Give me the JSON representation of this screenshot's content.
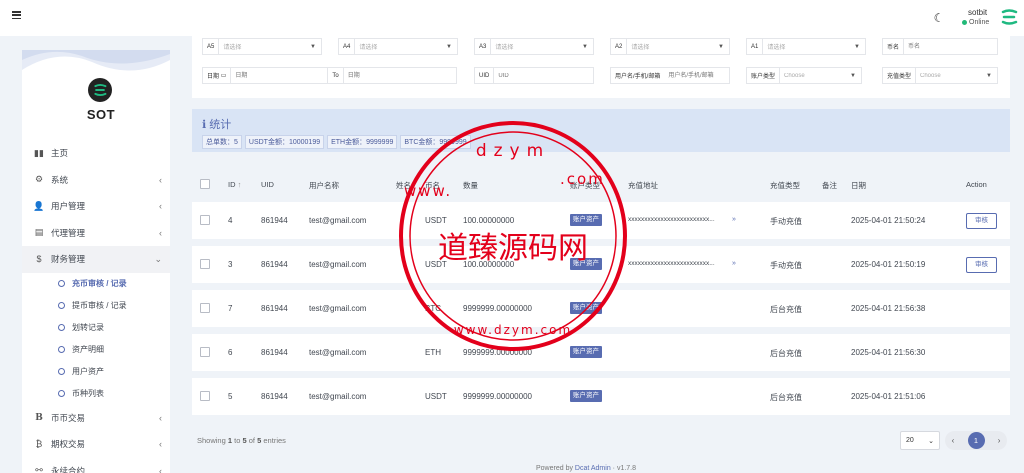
{
  "header": {
    "user_name": "sotbit",
    "user_status": "Online"
  },
  "sidebar": {
    "brand": "SOT",
    "items": [
      {
        "label": "主页",
        "icon": "bar-chart-icon"
      },
      {
        "label": "系统",
        "icon": "gear-icon"
      },
      {
        "label": "用户管理",
        "icon": "user-icon"
      },
      {
        "label": "代理管理",
        "icon": "id-card-icon"
      },
      {
        "label": "财务管理",
        "icon": "dollar-icon"
      }
    ],
    "sub_items": [
      {
        "label": "充币审核 / 记录"
      },
      {
        "label": "提币审核 / 记录"
      },
      {
        "label": "划转记录"
      },
      {
        "label": "资产明细"
      },
      {
        "label": "用户资产"
      },
      {
        "label": "币种列表"
      }
    ],
    "items_after": [
      {
        "label": "币币交易",
        "icon": "bitcoin-b-icon"
      },
      {
        "label": "期权交易",
        "icon": "bitcoin-icon"
      },
      {
        "label": "永续合约",
        "icon": "link-icon"
      }
    ]
  },
  "filters": {
    "row1": [
      {
        "label": "A5",
        "value": "请选择"
      },
      {
        "label": "A4",
        "value": "请选择"
      },
      {
        "label": "A3",
        "value": "请选择"
      },
      {
        "label": "A2",
        "value": "请选择"
      },
      {
        "label": "A1",
        "value": "请选择"
      },
      {
        "label": "币名",
        "value": "币名"
      }
    ],
    "row2": {
      "date_label": "日期",
      "date_from": "日期",
      "date_to_label": "To",
      "date_to": "日期",
      "uid_label": "UID",
      "uid_value": "UID",
      "user_label": "用户名/手机/邮箱",
      "user_value": "用户名/手机/邮箱",
      "account_type_label": "账户类型",
      "account_type_value": "Choose",
      "recharge_type_label": "充值类型",
      "recharge_type_value": "Choose"
    }
  },
  "stats": {
    "title": "统计",
    "chips": [
      "总单数：5",
      "USDT金额：10000199",
      "ETH金额：9999999",
      "BTC金额：9999999"
    ]
  },
  "table": {
    "headers": {
      "id": "ID",
      "uid": "UID",
      "username": "用户名称",
      "name": "姓名",
      "coin": "币名",
      "amount": "数量",
      "account_type": "账户类型",
      "address": "充值地址",
      "recharge_type": "充值类型",
      "remark": "备注",
      "date": "日期",
      "action": "Action"
    },
    "rows": [
      {
        "id": "4",
        "uid": "861944",
        "user": "test@gmail.com",
        "coin": "USDT",
        "amount": "100.00000000",
        "badge": "账户资产",
        "address": "xxxxxxxxxxxxxxxxxxxxxxxxx...",
        "type": "手动充值",
        "date": "2025-04-01 21:50:24",
        "action": "审核"
      },
      {
        "id": "3",
        "uid": "861944",
        "user": "test@gmail.com",
        "coin": "USDT",
        "amount": "100.00000000",
        "badge": "账户资产",
        "address": "xxxxxxxxxxxxxxxxxxxxxxxxx...",
        "type": "手动充值",
        "date": "2025-04-01 21:50:19",
        "action": "审核"
      },
      {
        "id": "7",
        "uid": "861944",
        "user": "test@gmail.com",
        "coin": "BTC",
        "amount": "9999999.00000000",
        "badge": "账户资产",
        "address": "",
        "type": "后台充值",
        "date": "2025-04-01 21:56:38",
        "action": ""
      },
      {
        "id": "6",
        "uid": "861944",
        "user": "test@gmail.com",
        "coin": "ETH",
        "amount": "9999999.00000000",
        "badge": "账户资产",
        "address": "",
        "type": "后台充值",
        "date": "2025-04-01 21:56:30",
        "action": ""
      },
      {
        "id": "5",
        "uid": "861944",
        "user": "test@gmail.com",
        "coin": "USDT",
        "amount": "9999999.00000000",
        "badge": "账户资产",
        "address": "",
        "type": "后台充值",
        "date": "2025-04-01 21:51:06",
        "action": ""
      }
    ]
  },
  "footer": {
    "showing_prefix": "Showing",
    "showing_from": "1",
    "showing_to_word": "to",
    "showing_to": "5",
    "showing_of_word": "of",
    "showing_total": "5",
    "showing_suffix": "entries",
    "per_page": "20",
    "current_page": "1",
    "powered_prefix": "Powered by",
    "powered_link": "Dcat Admin",
    "version": "v1.7.8"
  },
  "watermark": {
    "main": "道臻源码网",
    "top_letters": "dzym",
    "top_w": "www.",
    "com": ".com",
    "bottom": "www.dzym.com"
  },
  "colors": {
    "accent": "#586cb1",
    "online": "#21b978",
    "watermark": "#e3001b"
  }
}
